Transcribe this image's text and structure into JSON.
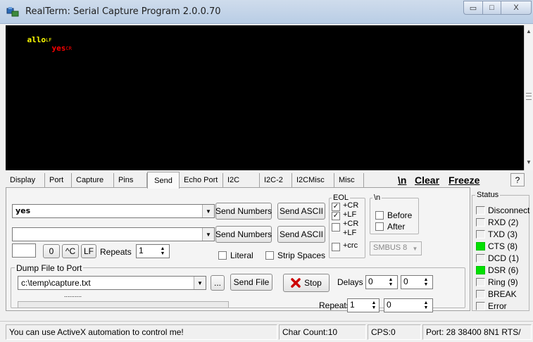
{
  "window": {
    "title": "RealTerm: Serial Capture Program 2.0.0.70",
    "minimize_glyph": "▭",
    "maximize_glyph": "□",
    "close_glyph": "X"
  },
  "terminal": {
    "lines": [
      {
        "text": "allo",
        "ctrl": "LF",
        "color": "#ffff00"
      },
      {
        "text": "yes",
        "ctrl": "CR",
        "color": "#ff0000"
      }
    ]
  },
  "tabs": [
    {
      "label": "Display",
      "active": false
    },
    {
      "label": "Port",
      "active": false
    },
    {
      "label": "Capture",
      "active": false
    },
    {
      "label": "Pins",
      "active": false
    },
    {
      "label": "Send",
      "active": true
    },
    {
      "label": "Echo Port",
      "active": false
    },
    {
      "label": "I2C",
      "active": false
    },
    {
      "label": "I2C-2",
      "active": false
    },
    {
      "label": "I2CMisc",
      "active": false
    },
    {
      "label": "Misc",
      "active": false
    }
  ],
  "toolbar": {
    "newline_label": "\\n",
    "clear_label": "Clear",
    "freeze_label": "Freeze",
    "help_label": "?"
  },
  "send": {
    "line1_value": "yes",
    "line2_value": "",
    "send_numbers_label": "Send Numbers",
    "send_ascii_label": "Send ASCII",
    "small_value": "",
    "zero_label": "0",
    "ctrl_c_label": "^C",
    "lf_label": "LF",
    "repeats_label": "Repeats",
    "repeats_value": "1",
    "literal_label": "Literal",
    "strip_spaces_label": "Strip Spaces"
  },
  "eol": {
    "title": "EOL",
    "items": [
      {
        "label": "+CR",
        "checked": true
      },
      {
        "label": "+LF",
        "checked": true
      },
      {
        "label": "+CR",
        "checked": false
      },
      {
        "label": "+LF",
        "checked": false
      },
      {
        "label": "+crc",
        "checked": false
      }
    ]
  },
  "newline_group": {
    "title": "\\n",
    "before_label": "Before",
    "after_label": "After"
  },
  "smbus": {
    "value": "SMBUS 8"
  },
  "dump": {
    "title": "Dump File to Port",
    "file_value": "c:\\temp\\capture.txt",
    "browse_label": "...",
    "send_file_label": "Send File",
    "stop_label": "Stop",
    "delays_label": "Delays",
    "delay1_value": "0",
    "delay2_value": "0",
    "progress_text": "..........",
    "progress": 0,
    "repeats_label": "Repeats",
    "repeats_value": "1",
    "repeats2_value": "0"
  },
  "status": {
    "title": "Status",
    "items": [
      {
        "label": "Disconnect",
        "on": false
      },
      {
        "label": "RXD (2)",
        "on": false
      },
      {
        "label": "TXD (3)",
        "on": false
      },
      {
        "label": "CTS (8)",
        "on": true
      },
      {
        "label": "DCD (1)",
        "on": false
      },
      {
        "label": "DSR (6)",
        "on": true
      },
      {
        "label": "Ring (9)",
        "on": false
      },
      {
        "label": "BREAK",
        "on": false
      },
      {
        "label": "Error",
        "on": false
      }
    ]
  },
  "statusbar": {
    "message": "You can use ActiveX automation to control me!",
    "char_count": "Char Count:10",
    "cps": "CPS:0",
    "port": "Port: 28 38400 8N1 RTS/"
  },
  "colors": {
    "led_on": "#00e000",
    "terminal_bg": "#000000",
    "stop_icon": "#cc0000"
  }
}
